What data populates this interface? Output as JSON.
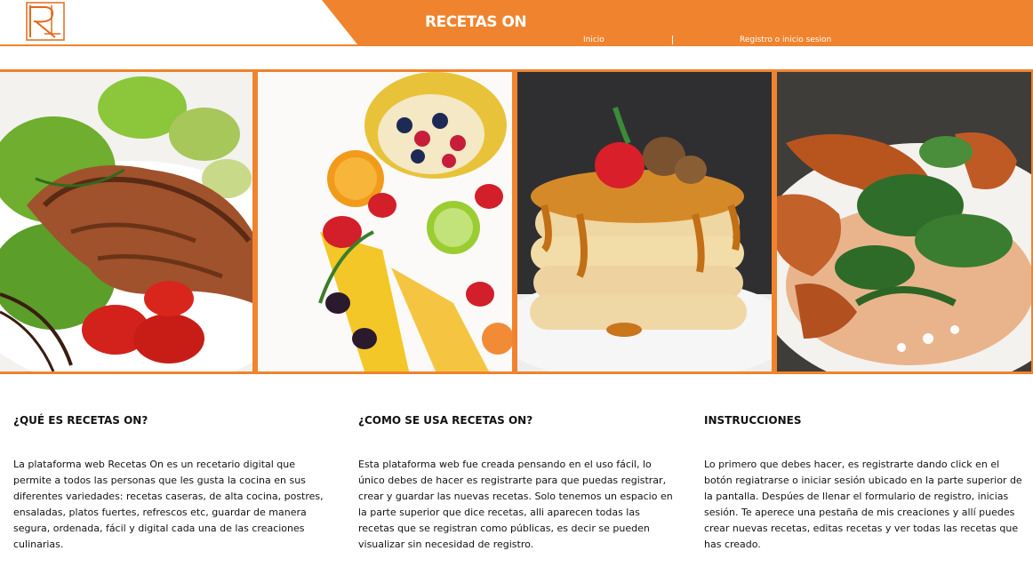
{
  "header": {
    "site_title": "RECETAS ON",
    "nav": {
      "home": "Inicio",
      "register_login": "Registro o inicio sesion"
    }
  },
  "gallery": {
    "photos": [
      "grilled-salmon-salad-photo",
      "fruit-platter-photo",
      "pancake-stack-photo",
      "chicken-salad-photo"
    ]
  },
  "sections": [
    {
      "title": "¿QUÉ ES RECETAS ON?",
      "body": "La plataforma web Recetas On es un recetario digital que permite a todos las personas que les gusta la cocina en sus diferentes variedades: recetas caseras, de alta cocina, postres, ensaladas, platos fuertes, refrescos etc, guardar de manera segura, ordenada, fácil y digital cada una de las creaciones culinarias."
    },
    {
      "title": "¿COMO SE USA RECETAS ON?",
      "body": "Esta plataforma web fue creada pensando en el uso fácil, lo único debes de hacer es registrarte para que puedas registrar, crear y guardar las nuevas recetas. Solo tenemos un espacio en la parte superior que dice recetas, alli aparecen todas las recetas que se registran como públicas, es decir se pueden visualizar sin necesidad de registro."
    },
    {
      "title": "INSTRUCCIONES",
      "body": "Lo primero que debes hacer, es registrarte dando click en el botón regiatrarse o iniciar sesión ubicado en la parte superior de la pantalla. Despúes de llenar el formulario de registro, inicias sesión. Te aperece una pestaña de mis creaciones y allí puedes crear nuevas recetas, editas recetas y ver todas las recetas que has creado."
    }
  ],
  "colors": {
    "accent": "#f0832d",
    "text": "#111111",
    "background": "#ffffff"
  }
}
